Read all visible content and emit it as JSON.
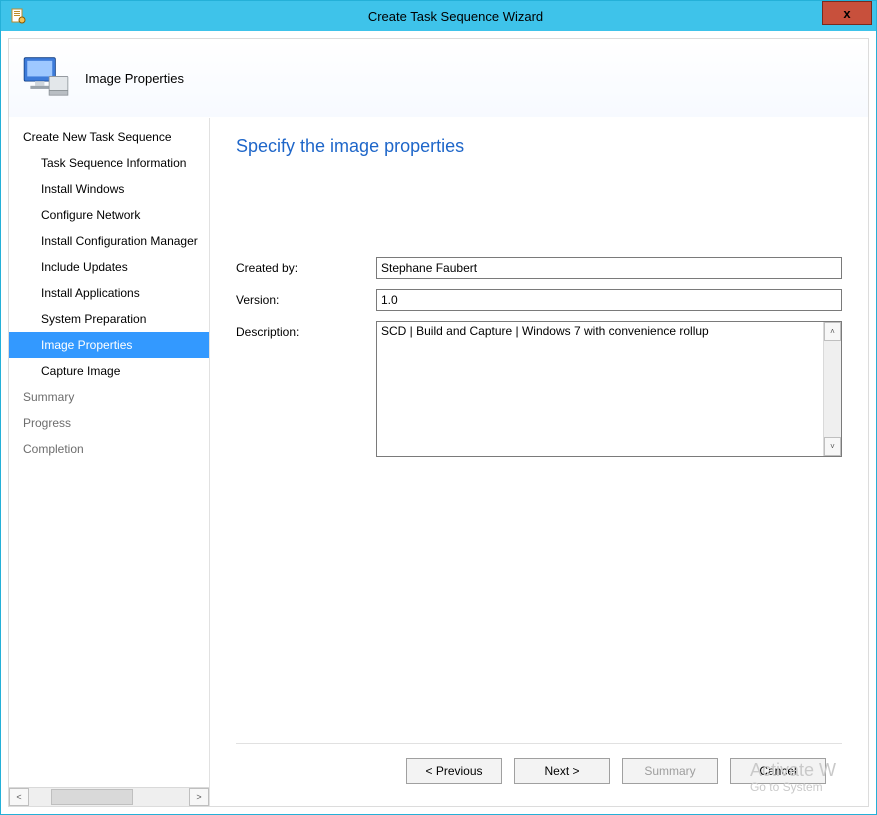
{
  "window": {
    "title": "Create Task Sequence Wizard",
    "close": "x"
  },
  "header": {
    "page_title": "Image Properties"
  },
  "sidebar": {
    "items": [
      {
        "label": "Create New Task Sequence",
        "sub": false,
        "selected": false,
        "dim": false
      },
      {
        "label": "Task Sequence Information",
        "sub": true,
        "selected": false,
        "dim": false
      },
      {
        "label": "Install Windows",
        "sub": true,
        "selected": false,
        "dim": false
      },
      {
        "label": "Configure Network",
        "sub": true,
        "selected": false,
        "dim": false
      },
      {
        "label": "Install Configuration Manager",
        "sub": true,
        "selected": false,
        "dim": false
      },
      {
        "label": "Include Updates",
        "sub": true,
        "selected": false,
        "dim": false
      },
      {
        "label": "Install Applications",
        "sub": true,
        "selected": false,
        "dim": false
      },
      {
        "label": "System Preparation",
        "sub": true,
        "selected": false,
        "dim": false
      },
      {
        "label": "Image Properties",
        "sub": true,
        "selected": true,
        "dim": false
      },
      {
        "label": "Capture Image",
        "sub": true,
        "selected": false,
        "dim": false
      },
      {
        "label": "Summary",
        "sub": false,
        "selected": false,
        "dim": true
      },
      {
        "label": "Progress",
        "sub": false,
        "selected": false,
        "dim": true
      },
      {
        "label": "Completion",
        "sub": false,
        "selected": false,
        "dim": true
      }
    ],
    "scroll": {
      "left": "<",
      "right": ">",
      "thumb": "III"
    }
  },
  "content": {
    "heading": "Specify the image properties",
    "labels": {
      "created_by": "Created by:",
      "version": "Version:",
      "description": "Description:"
    },
    "values": {
      "created_by": "Stephane Faubert",
      "version": "1.0",
      "description": "SCD | Build and Capture | Windows 7 with convenience rollup"
    }
  },
  "footer": {
    "previous": "< Previous",
    "next": "Next >",
    "summary": "Summary",
    "cancel": "Cancel"
  },
  "watermark": {
    "line1": "Activate W",
    "line2": "Go to System"
  }
}
